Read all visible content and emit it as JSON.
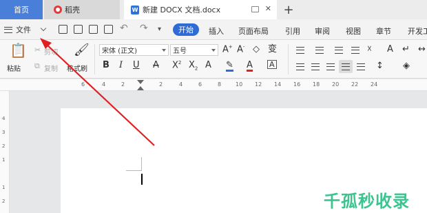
{
  "tabs": {
    "home": "首页",
    "daoke": "稻壳",
    "document": "新建 DOCX 文档.docx",
    "doc_icon": "W"
  },
  "menubar": {
    "file": "文件",
    "start": "开始",
    "items": [
      "插入",
      "页面布局",
      "引用",
      "审阅",
      "视图",
      "章节",
      "开发工"
    ]
  },
  "ribbon": {
    "paste": "粘贴",
    "cut": "剪切",
    "copy": "复制",
    "format_painter": "格式刷",
    "font_name": "宋体 (正文)",
    "font_size": "五号"
  },
  "ruler": {
    "top_numbers": [
      "6",
      "4",
      "2",
      "2",
      "4",
      "6",
      "8",
      "10",
      "12",
      "14",
      "16",
      "18",
      "20",
      "22",
      "24"
    ],
    "left_numbers": [
      "4",
      "3",
      "2",
      "1",
      "1",
      "2"
    ]
  },
  "watermark": "千孤秒收录",
  "colors": {
    "home_tab": "#4a7fd9",
    "start_button": "#2f6bd4",
    "arrow": "#e02020",
    "watermark": "#3cc38f"
  }
}
